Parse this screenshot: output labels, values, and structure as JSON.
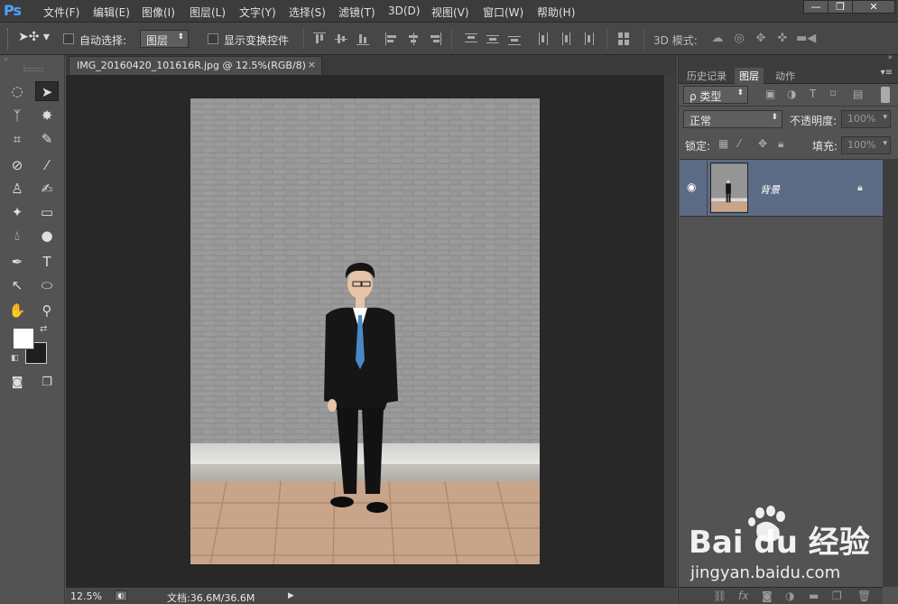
{
  "app": {
    "logo": "Ps"
  },
  "menubar": {
    "items": [
      "文件(F)",
      "编辑(E)",
      "图像(I)",
      "图层(L)",
      "文字(Y)",
      "选择(S)",
      "滤镜(T)",
      "3D(D)",
      "视图(V)",
      "窗口(W)",
      "帮助(H)"
    ],
    "window_buttons": {
      "minimize": "—",
      "restore": "❐",
      "close": "✕"
    }
  },
  "options": {
    "auto_select_label": "自动选择:",
    "auto_select_value": "图层",
    "show_transform_label": "显示变换控件",
    "mode_3d_label": "3D 模式:"
  },
  "document": {
    "tab_title": "IMG_20160420_101616R.jpg @ 12.5%(RGB/8)",
    "tab_close": "×",
    "zoom": "12.5%",
    "doc_size": "文档:36.6M/36.6M"
  },
  "panels": {
    "tabs": [
      "历史记录",
      "图层",
      "动作"
    ],
    "active_tab": "图层",
    "filter_kind": "ρ 类型",
    "blend_mode": "正常",
    "opacity_label": "不透明度:",
    "opacity_value": "100%",
    "lock_label": "锁定:",
    "fill_label": "填充:",
    "fill_value": "100%",
    "layers": [
      {
        "name": "背景",
        "visible": true,
        "locked": true
      }
    ]
  },
  "watermark": {
    "text_top": "Bai du 经验",
    "text_bottom": "jingyan.baidu.com"
  },
  "colors": {
    "accent_logo": "#4ea2ff",
    "selected_layer": "#5c6b85",
    "foreground": "#ffffff",
    "background": "#1e1e1e"
  }
}
